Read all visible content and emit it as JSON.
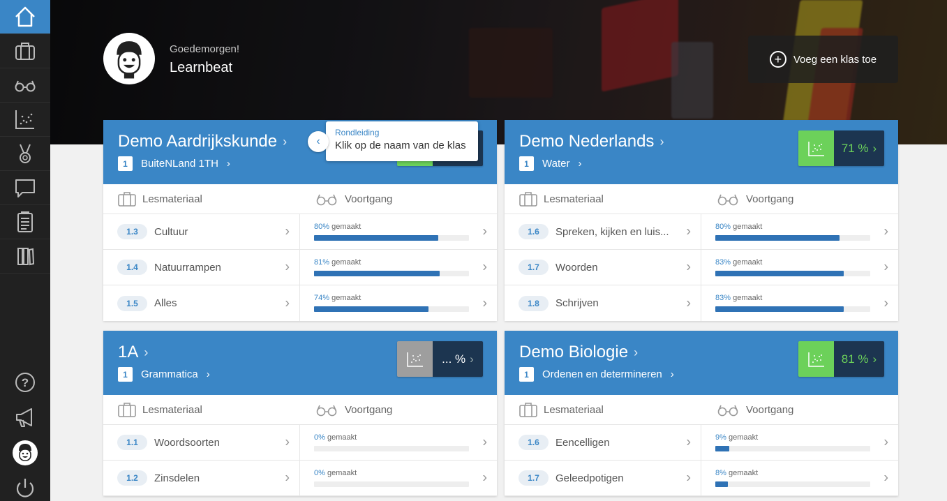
{
  "sidebar": {
    "items": [
      {
        "icon": "home-icon",
        "active": true
      },
      {
        "icon": "briefcase-icon"
      },
      {
        "icon": "glasses-icon"
      },
      {
        "icon": "chart-icon"
      },
      {
        "icon": "medal-icon"
      },
      {
        "icon": "chat-icon"
      },
      {
        "icon": "clipboard-icon"
      },
      {
        "icon": "books-icon"
      },
      {
        "icon": "help-icon"
      },
      {
        "icon": "megaphone-icon"
      },
      {
        "icon": "avatar-icon"
      },
      {
        "icon": "power-icon"
      }
    ]
  },
  "header": {
    "greeting": "Goedemorgen!",
    "username": "Learnbeat",
    "add_class_label": "Voeg een klas toe"
  },
  "tooltip": {
    "title": "Rondleiding",
    "text": "Klik op de naam van de klas"
  },
  "labels": {
    "material": "Lesmateriaal",
    "progress": "Voortgang",
    "done_suffix": "gemaakt"
  },
  "cards": [
    {
      "title": "Demo Aardrijkskunde",
      "level": "1",
      "subtitle": "BuiteNLand 1TH",
      "score": "",
      "rows": [
        {
          "num": "1.3",
          "name": "Cultuur",
          "percent": "80%",
          "fill": 0.8
        },
        {
          "num": "1.4",
          "name": "Natuurrampen",
          "percent": "81%",
          "fill": 0.81
        },
        {
          "num": "1.5",
          "name": "Alles",
          "percent": "74%",
          "fill": 0.74
        }
      ]
    },
    {
      "title": "Demo Nederlands",
      "level": "1",
      "subtitle": "Water",
      "score": "71 %",
      "rows": [
        {
          "num": "1.6",
          "name": "Spreken, kijken en luis...",
          "percent": "80%",
          "fill": 0.8
        },
        {
          "num": "1.7",
          "name": "Woorden",
          "percent": "83%",
          "fill": 0.83
        },
        {
          "num": "1.8",
          "name": "Schrijven",
          "percent": "83%",
          "fill": 0.83
        }
      ]
    },
    {
      "title": "1A",
      "level": "1",
      "subtitle": "Grammatica",
      "score": "... %",
      "rows": [
        {
          "num": "1.1",
          "name": "Woordsoorten",
          "percent": "0%",
          "fill": 0
        },
        {
          "num": "1.2",
          "name": "Zinsdelen",
          "percent": "0%",
          "fill": 0
        }
      ]
    },
    {
      "title": "Demo Biologie",
      "level": "1",
      "subtitle": "Ordenen en determineren",
      "score": "81 %",
      "rows": [
        {
          "num": "1.6",
          "name": "Eencelligen",
          "percent": "9%",
          "fill": 0.09
        },
        {
          "num": "1.7",
          "name": "Geleedpotigen",
          "percent": "8%",
          "fill": 0.08
        }
      ]
    }
  ],
  "colors": {
    "accent": "#3a86c6",
    "score_green": "#6cd15a",
    "sidebar_bg": "#212121",
    "score_dark": "#1c3550"
  }
}
